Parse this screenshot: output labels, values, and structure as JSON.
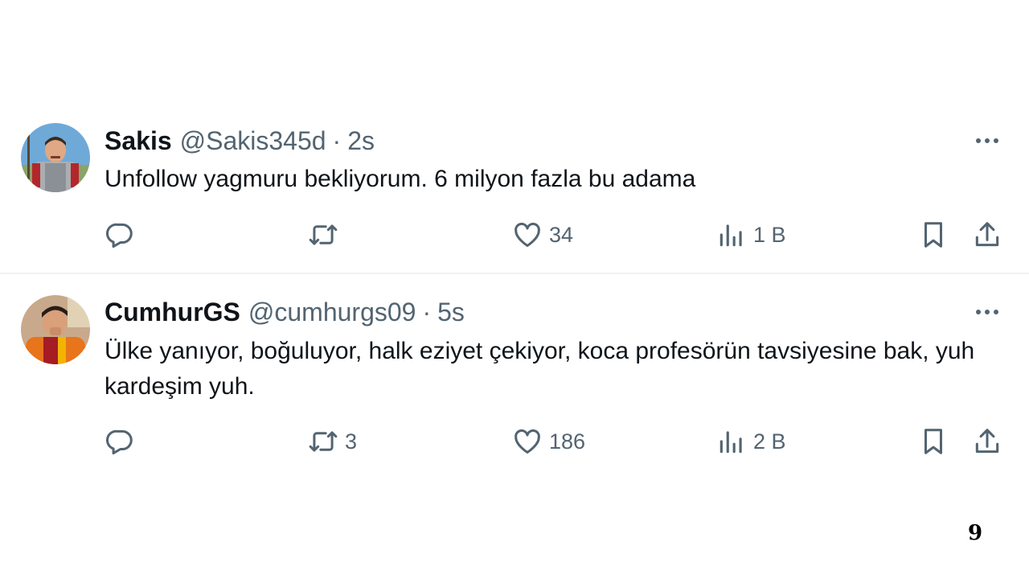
{
  "tweets": [
    {
      "name": "Sakis",
      "handle": "@Sakis345d",
      "separator": "·",
      "time": "2s",
      "text": "Unfollow yagmuru bekliyorum. 6 milyon fazla bu adama",
      "avatar": "warrior-armor-avatar",
      "reply_count": "",
      "retweet_count": "",
      "like_count": "34",
      "view_count": "1 B"
    },
    {
      "name": "CumhurGS",
      "handle": "@cumhurgs09",
      "separator": "·",
      "time": "5s",
      "text": "Ülke yanıyor, boğuluyor, halk eziyet çekiyor, koca profesörün tavsiyesine bak, yuh kardeşim yuh.",
      "avatar": "galatasaray-jersey-avatar",
      "reply_count": "",
      "retweet_count": "3",
      "like_count": "186",
      "view_count": "2 B"
    }
  ],
  "icons": {
    "reply": "reply-icon",
    "retweet": "retweet-icon",
    "like": "heart-icon",
    "views": "views-icon",
    "bookmark": "bookmark-icon",
    "share": "share-icon",
    "more": "more-icon"
  },
  "colors": {
    "text": "#0f1419",
    "secondary": "#536471",
    "divider": "#eff3f4"
  },
  "page_number": "9"
}
